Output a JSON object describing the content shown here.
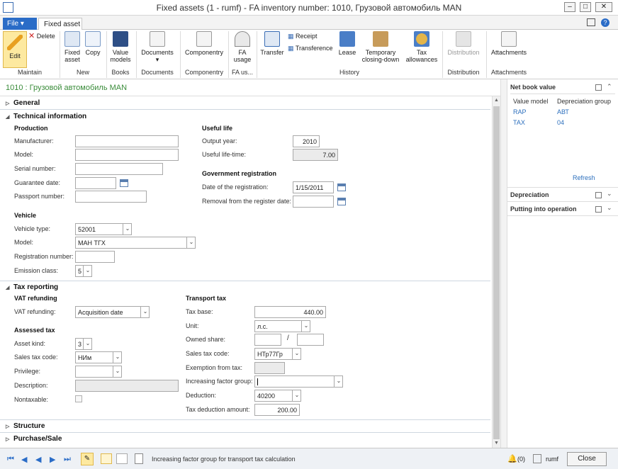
{
  "window": {
    "title": "Fixed assets (1 - rumf) - FA inventory number: 1010, Грузовой автомобиль MAN"
  },
  "tabs": {
    "file": "File",
    "fixed_asset": "Fixed asset"
  },
  "ribbon": {
    "edit": "Edit",
    "delete": "Delete",
    "fixed_asset_l1": "Fixed",
    "fixed_asset_l2": "asset",
    "copy": "Copy",
    "value_models_l1": "Value",
    "value_models_l2": "models",
    "documents": "Documents",
    "componentry": "Componentry",
    "fa_usage_l1": "FA",
    "fa_usage_l2": "usage",
    "transfer": "Transfer",
    "receipt": "Receipt",
    "transference": "Transference",
    "lease": "Lease",
    "temp_closing_l1": "Temporary",
    "temp_closing_l2": "closing-down",
    "tax_allowances_l1": "Tax",
    "tax_allowances_l2": "allowances",
    "distribution": "Distribution",
    "attachments": "Attachments",
    "groups": {
      "maintain": "Maintain",
      "new": "New",
      "books": "Books",
      "documents": "Documents",
      "componentry": "Componentry",
      "fa_usage": "FA us...",
      "history": "History",
      "distribution": "Distribution",
      "attachments": "Attachments"
    }
  },
  "record_title": "1010 : Грузовой автомобиль MAN",
  "sections": {
    "general": "General",
    "technical": "Technical information",
    "tax_reporting": "Tax reporting",
    "structure": "Structure",
    "purchase_sale": "Purchase/Sale"
  },
  "technical": {
    "production": {
      "title": "Production",
      "manufacturer": "Manufacturer:",
      "model": "Model:",
      "serial": "Serial number:",
      "guarantee": "Guarantee date:",
      "passport": "Passport number:"
    },
    "useful_life": {
      "title": "Useful life",
      "output_year_label": "Output year:",
      "output_year": "2010",
      "lifetime_label": "Useful life-time:",
      "lifetime": "7.00"
    },
    "gov_reg": {
      "title": "Government registration",
      "date_label": "Date of the registration:",
      "date": "1/15/2011",
      "removal_label": "Removal from the register date:"
    },
    "vehicle": {
      "title": "Vehicle",
      "type_label": "Vehicle type:",
      "type": "52001",
      "model_label": "Model:",
      "model": "МАН ТГХ",
      "regnum_label": "Registration number:",
      "emission_label": "Emission class:",
      "emission": "5"
    }
  },
  "tax": {
    "vat": {
      "title": "VAT refunding",
      "label": "VAT refunding:",
      "value": "Acquisition date"
    },
    "assessed": {
      "title": "Assessed tax",
      "kind_label": "Asset kind:",
      "kind": "3",
      "code_label": "Sales tax code:",
      "code": "НИм",
      "privilege_label": "Privilege:",
      "desc_label": "Description:",
      "nontax_label": "Nontaxable:"
    },
    "transport": {
      "title": "Transport tax",
      "base_label": "Tax base:",
      "base": "440.00",
      "unit_label": "Unit:",
      "unit": "л.с.",
      "share_label": "Owned share:",
      "share_sep": "/",
      "code_label": "Sales tax code:",
      "code": "НТр77Гр",
      "exemption_label": "Exemption from tax:",
      "factor_label": "Increasing factor group:",
      "deduction_label": "Deduction:",
      "deduction": "40200",
      "amount_label": "Tax deduction amount:",
      "amount": "200.00"
    }
  },
  "right_pane": {
    "nbv_title": "Net book value",
    "col_model": "Value model",
    "col_group": "Depreciation group",
    "rows": [
      {
        "model": "RAP",
        "group": "АВТ"
      },
      {
        "model": "TAX",
        "group": "04"
      }
    ],
    "refresh": "Refresh",
    "depreciation": "Depreciation",
    "putting": "Putting into operation"
  },
  "status": {
    "help_text": "Increasing factor group for transport tax calculation",
    "alerts": "(0)",
    "company": "rumf",
    "close": "Close"
  }
}
